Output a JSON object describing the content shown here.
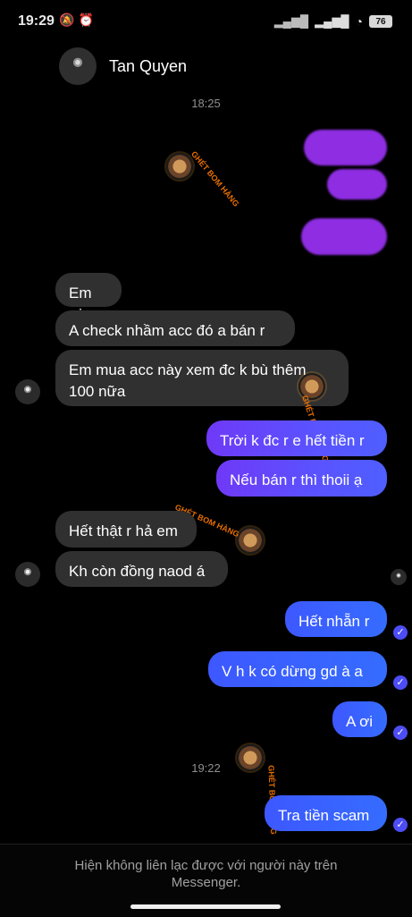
{
  "status_bar": {
    "time": "19:29",
    "battery": "76",
    "icons": [
      "mute-icon",
      "alarm-icon",
      "signal-icon",
      "signal-icon",
      "wifi-icon",
      "battery-icon"
    ]
  },
  "header": {
    "contact_name": "Tan Quyen"
  },
  "timestamps": {
    "top": "18:25",
    "bottom": "19:22"
  },
  "messages": {
    "left": [
      "Em ơi",
      "A check nhầm acc đó a bán r",
      "Em mua acc này xem đc k bù thêm 100 nữa",
      "Hết thật r hả em",
      "Kh còn đồng naod á"
    ],
    "right": [
      "Trời k đc r e hết tiền r",
      "Nếu bán r thì thoii ạ",
      "Hết nhẵn r",
      "V h k có dừng gd à a",
      "A ơi",
      "Tra tiền scam"
    ]
  },
  "watermark": {
    "label": "GHÉT BOM HÀNG"
  },
  "bottom_notice": {
    "line1": "Hiện không liên lạc được với người này trên",
    "line2": "Messenger."
  },
  "colors": {
    "background": "#000000",
    "left_bubble": "#303030",
    "right_bubble_start": "#6f39f7",
    "right_bubble_end": "#4f5eff",
    "watermark": "#ff7a00"
  }
}
